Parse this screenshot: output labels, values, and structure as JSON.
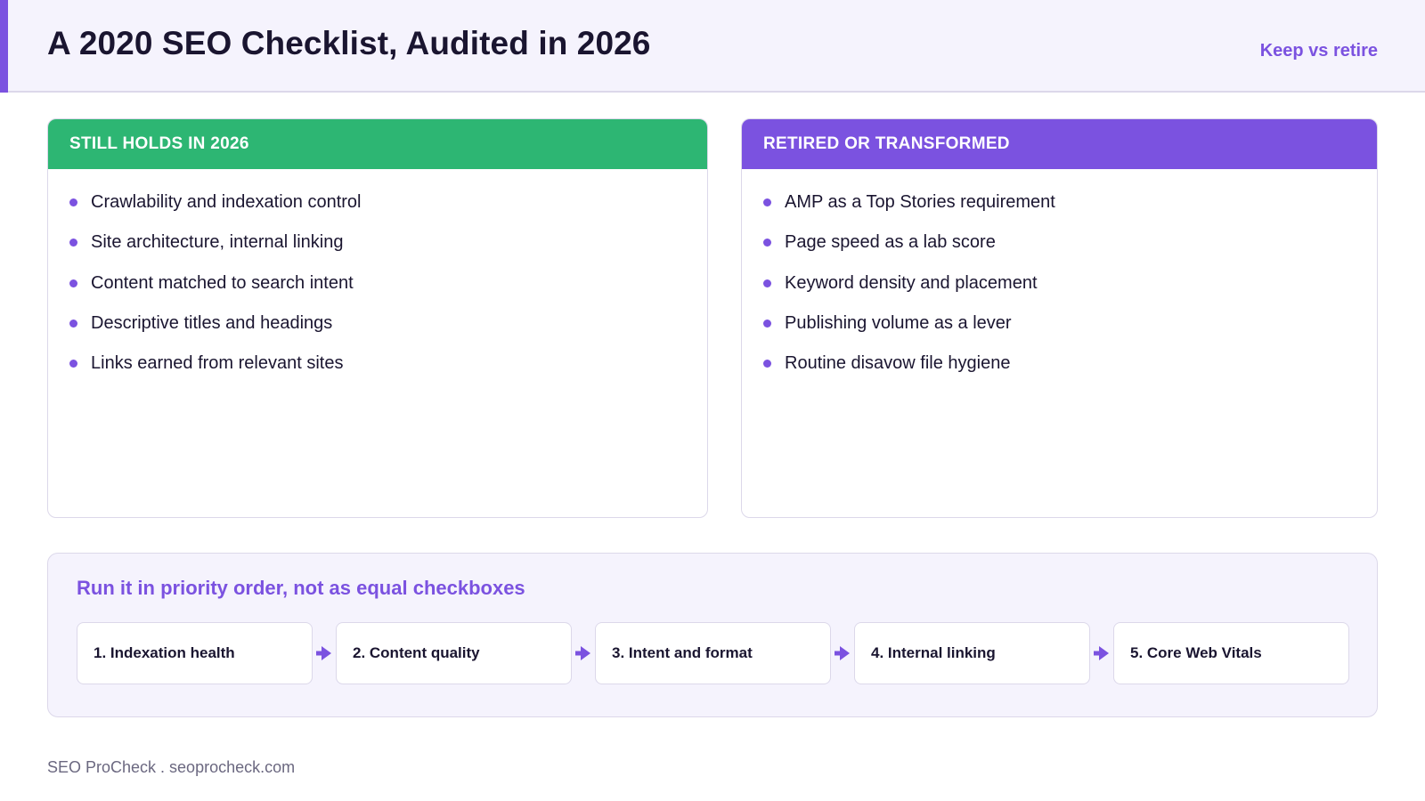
{
  "header": {
    "title": "A 2020 SEO Checklist, Audited in 2026",
    "tag": "Keep vs retire"
  },
  "left_card": {
    "heading": "STILL HOLDS IN 2026",
    "items": [
      "Crawlability and indexation control",
      "Site architecture, internal linking",
      "Content matched to search intent",
      "Descriptive titles and headings",
      "Links earned from relevant sites"
    ]
  },
  "right_card": {
    "heading": "RETIRED OR TRANSFORMED",
    "items": [
      "AMP as a Top Stories requirement",
      "Page speed as a lab score",
      "Keyword density and placement",
      "Publishing volume as a lever",
      "Routine disavow file hygiene"
    ]
  },
  "priority": {
    "title": "Run it in priority order, not as equal checkboxes",
    "steps": [
      "1. Indexation health",
      "2. Content quality",
      "3. Intent and format",
      "4. Internal linking",
      "5. Core Web Vitals"
    ]
  },
  "footer": {
    "text": "SEO ProCheck . seoprocheck.com"
  },
  "colors": {
    "accent": "#7b52e0",
    "keep": "#2db673",
    "panel_bg": "#f5f3fd",
    "border": "#dcd8ea"
  },
  "icons": {
    "bullet": "bullet-dot-icon",
    "step_arrow": "arrow-right-icon"
  }
}
